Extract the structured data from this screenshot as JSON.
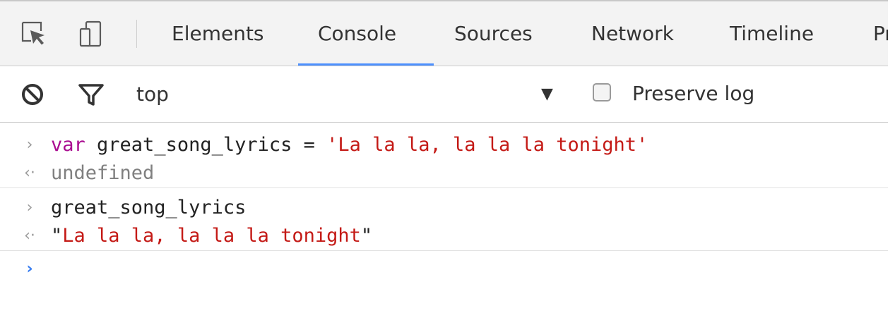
{
  "tabs": [
    {
      "label": "Elements",
      "active": false
    },
    {
      "label": "Console",
      "active": true
    },
    {
      "label": "Sources",
      "active": false
    },
    {
      "label": "Network",
      "active": false
    },
    {
      "label": "Timeline",
      "active": false
    },
    {
      "label": "Pr",
      "active": false
    }
  ],
  "toolbar_icons": {
    "inspect": "inspect-element-icon",
    "device": "device-mode-icon",
    "clear": "clear-console-icon",
    "filter": "filter-icon",
    "dropdown": "dropdown-arrow-icon"
  },
  "console_toolbar": {
    "context": "top",
    "context_arrow": "▼",
    "preserve_log_label": "Preserve log",
    "preserve_log_checked": false
  },
  "console": {
    "input_glyph": "›",
    "output_glyph": "‹·",
    "entries": [
      {
        "type": "input",
        "keyword": "var",
        "code": " great_song_lyrics = ",
        "string": "'La la la, la la la tonight'"
      },
      {
        "type": "output",
        "text": "undefined"
      },
      {
        "type": "input",
        "code": "great_song_lyrics"
      },
      {
        "type": "output",
        "open_quote": "\"",
        "string": "La la la, la la la tonight",
        "close_quote": "\""
      }
    ],
    "prompt_glyph": "›"
  },
  "colors": {
    "tab_underline": "#4d90fe",
    "keyword": "#aa0d91",
    "string": "#c41a16",
    "prompt": "#367cf1",
    "muted": "#808080"
  }
}
